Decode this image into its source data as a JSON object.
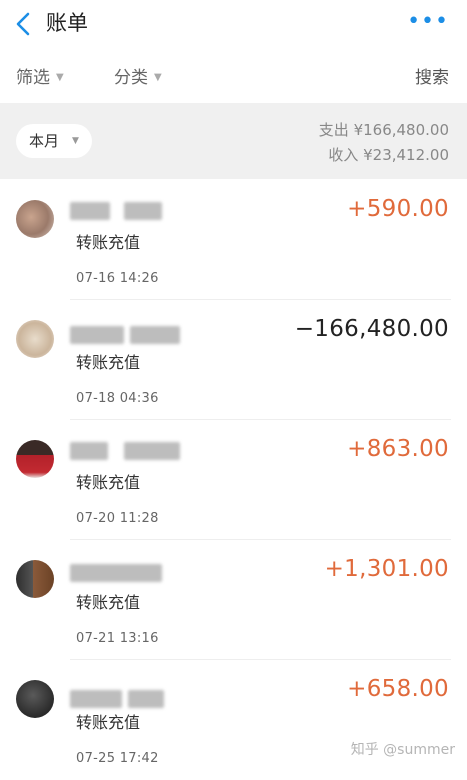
{
  "header": {
    "title": "账单",
    "more_icon": "more-dots-icon",
    "back_icon": "back-chevron-icon",
    "accent": "#1c8ee6"
  },
  "filters": {
    "filter_label": "筛选",
    "category_label": "分类",
    "search_label": "搜索"
  },
  "summary": {
    "month_label": "本月",
    "expense": "支出 ¥166,480.00",
    "income": "收入 ¥23,412.00"
  },
  "transactions": [
    {
      "desc": "转账充值",
      "time": "07-16   14:26",
      "amount": "+590.00",
      "type": "income"
    },
    {
      "desc": "转账充值",
      "time": "07-18   04:36",
      "amount": "−166,480.00",
      "type": "expense"
    },
    {
      "desc": "转账充值",
      "time": "07-20   11:28",
      "amount": "+863.00",
      "type": "income"
    },
    {
      "desc": "转账充值",
      "time": "07-21   13:16",
      "amount": "+1,301.00",
      "type": "income"
    },
    {
      "desc": "转账充值",
      "time": "07-25   17:42",
      "amount": "+658.00",
      "type": "income"
    }
  ],
  "colors": {
    "income": "#e06a3b",
    "expense": "#222222"
  },
  "watermark": "知乎 @summer"
}
